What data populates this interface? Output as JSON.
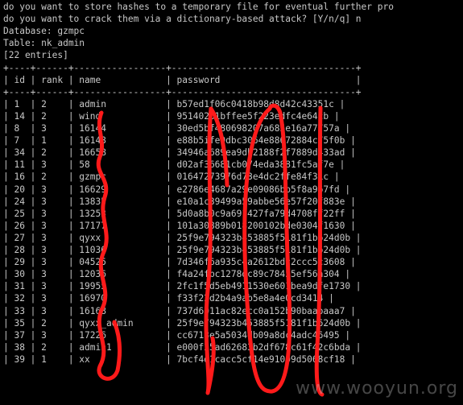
{
  "terminal": {
    "lines": [
      "do you want to store hashes to a temporary file for eventual further pro",
      "do you want to crack them via a dictionary-based attack? [Y/n/q] n",
      "Database: gzmpc",
      "Table: nk_admin",
      "[22 entries]",
      "+----+------+-----------------+----------------------------------+",
      "| id | rank | name            | password                         |",
      "+----+------+-----------------+----------------------------------+",
      "| 1  | 2    | admin           | b57ed1f06c0418b98d8d42c43351c |",
      "| 14 | 2    | wind            | 95140261bffee5f223edfc4e64cb |",
      "| 8  | 3    | 16144           | 30ed5bf480698207a685e16a77757a |",
      "| 7  | 1    | 16143           | e88b5ife0dbc3064e88672884c75f0b |",
      "| 34 | 2    | 16658           | 34946a689ea9db2188f2f7889d433ad |",
      "| 11 | 3    | 58              | d02af36681cb074eda3881fc5af7e |",
      "| 16 | 2    | gzmpc           | 01647273976d73e4dc2ffe84f31c |",
      "| 20 | 3    | 16629           | e2786e4687a29e09086bb5f8a967fd |",
      "| 24 | 3    | 13835           | e10a1c39499a59abbe56e57f20f883e |",
      "| 25 | 3    | 13253           | 5d0a8b0c9a691427fa79d4708ff22ff |",
      "| 26 | 3    | 17177           | 101a30889b018200102bde0304f1630 |",
      "| 27 | 3    | qyxx            | 25f9e794323b453885f5181f1b624d0b |",
      "| 28 | 3    | 11036           | 25f9e794323b453885f5181f1b624d0b |",
      "| 29 | 3    | 04525           | 7d346f6a935c4a2612bdc2ccc5c3608 |",
      "| 30 | 3    | 12036           | f4a24fbc1278dc89c78455ef56a304 |",
      "| 31 | 3    | 19955           | 2fc1f5d5eb4911530e601bea9dfe1730 |",
      "| 32 | 3    | 16970           | f33f22d2b4a9ab5e8a4e0cd3414 |",
      "| 33 | 3    | 16168           | 737d6011ac82ecc0a152b90baabaaa7 |",
      "| 35 | 2    | qyxx_admin      | 25f9e794323b453885f5181f1b624d0b |",
      "| 37 | 3    | 17226           | cc6718e5a5034db09a8dc4adc46495 |",
      "| 38 | 2    | admin1          | e000f25ad62683b2df678c61f42c6bda |",
      "| 39 | 1    | xx              | 7bcf4d1cacc5cf14e91009d5068cf18 |"
    ],
    "watermark": "www.wooyun.org",
    "scribble_color": "#ff1a1a"
  }
}
